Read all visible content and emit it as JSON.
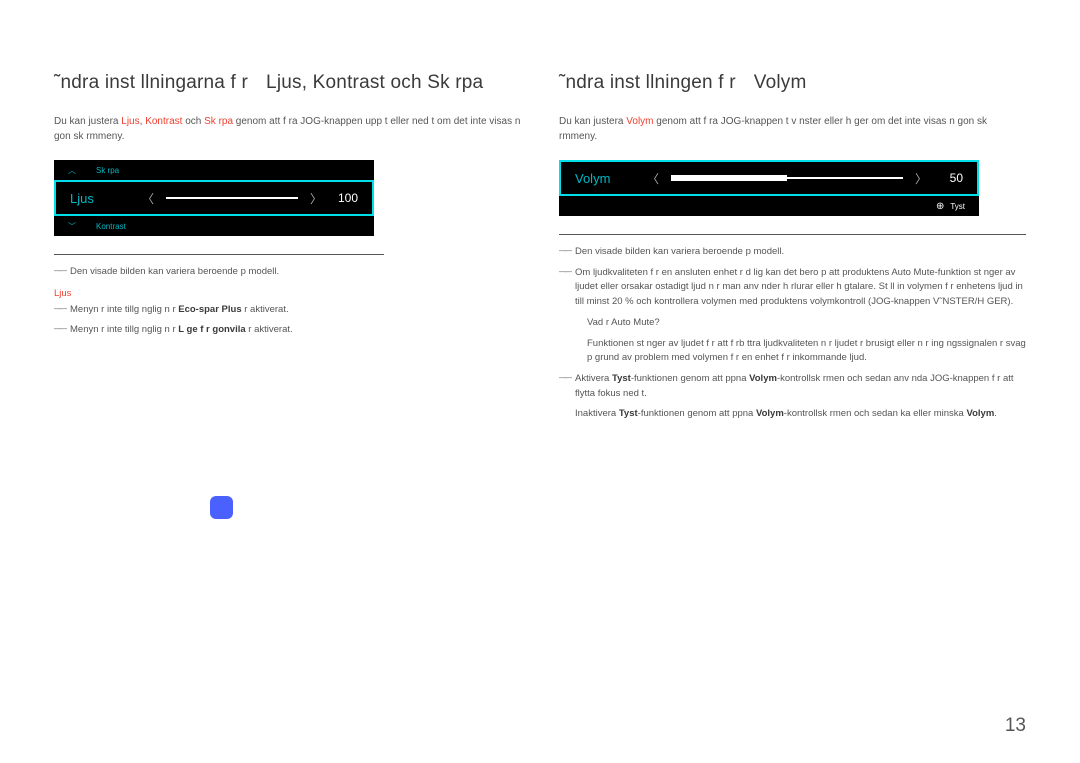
{
  "left": {
    "heading_a": "˜ndra inst llningarna f r",
    "heading_b": "Ljus, Kontrast och Sk rpa",
    "intro_pre": "Du kan justera ",
    "hl1": "Ljus",
    "sep1": ", ",
    "hl2": "Kontrast",
    "sep2": " och ",
    "hl3": "Sk rpa",
    "intro_post": " genom att f ra JOG-knappen upp t eller ned t om det inte visas n gon sk rmmeny.",
    "osd": {
      "top_label": "Sk rpa",
      "main_label": "Ljus",
      "main_value": "100",
      "bottom_label": "Kontrast"
    },
    "note_model": "Den visade bilden kan variera beroende p  modell.",
    "ljus_label": "Ljus",
    "bullet1_a": "Menyn  r inte tillg nglig n r ",
    "bullet1_hl": "Eco-spar Plus",
    "bullet1_b": "  r aktiverat.",
    "bullet2_a": "Menyn  r inte tillg nglig n r ",
    "bullet2_hl": "L ge f r  gonvila",
    "bullet2_b": "  r aktiverat."
  },
  "right": {
    "heading_a": "˜ndra inst llningen f r",
    "heading_b": "Volym",
    "intro_pre": "Du kan justera ",
    "hl1": "Volym",
    "intro_post": " genom att f ra JOG-knappen  t v nster eller h ger om det inte visas n gon sk rmmeny.",
    "osd": {
      "main_label": "Volym",
      "main_value": "50",
      "sub_label": "Tyst"
    },
    "note_model": "Den visade bilden kan variera beroende p  modell.",
    "para1": "Om ljudkvaliteten f r en ansluten enhet  r d lig kan det bero p  att produktens Auto Mute-funktion st nger av ljudet eller orsakar ostadigt ljud n r man anv nder h rlurar eller h gtalare. St ll in volymen f r enhetens ljud in till minst 20 % och kontrollera volymen med produktens volymkontroll (JOG-knappen V˜NSTER/H GER).",
    "q": "Vad  r Auto Mute?",
    "a": "Funktionen st nger av ljudet f r att f rb ttra ljudkvaliteten n r ljudet  r brusigt eller n r ing ngssignalen  r svag p  grund av problem med volymen f r en enhet f r inkommande ljud.",
    "para2_a": "Aktivera ",
    "para2_hl1": "Tyst",
    "para2_b": "-funktionen genom att  ppna ",
    "para2_hl2": "Volym",
    "para2_c": "-kontrollsk rmen och sedan anv nda JOG-knappen f r att flytta fokus ned t.",
    "para3_a": "Inaktivera ",
    "para3_hl1": "Tyst",
    "para3_b": "-funktionen genom att  ppna ",
    "para3_hl2": "Volym",
    "para3_c": "-kontrollsk rmen och sedan  ka eller minska ",
    "para3_hl3": "Volym",
    "para3_d": "."
  },
  "page_number": "13"
}
